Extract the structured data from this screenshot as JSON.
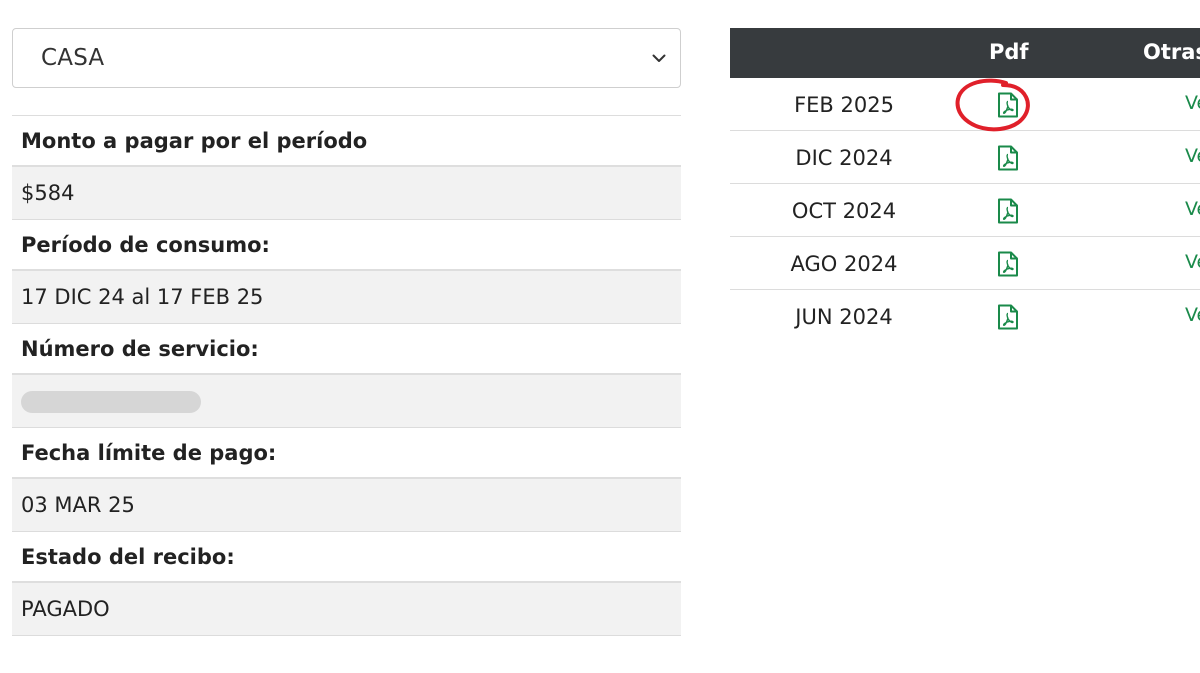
{
  "selector": {
    "value": "CASA"
  },
  "details": [
    {
      "label": "Monto a pagar por el período",
      "value": "$584"
    },
    {
      "label": "Período de consumo:",
      "value": "17 DIC 24 al 17 FEB 25"
    },
    {
      "label": "Número de servicio:",
      "value": ""
    },
    {
      "label": "Fecha límite de pago:",
      "value": "03 MAR 25"
    },
    {
      "label": "Estado del recibo:",
      "value": "PAGADO"
    }
  ],
  "table": {
    "headers": {
      "pdf": "Pdf",
      "otras": "Otras"
    },
    "rows": [
      {
        "period": "FEB 2025",
        "link": "Ver"
      },
      {
        "period": "DIC 2024",
        "link": "Ver"
      },
      {
        "period": "OCT 2024",
        "link": "Ver"
      },
      {
        "period": "AGO 2024",
        "link": "Ver"
      },
      {
        "period": "JUN 2024",
        "link": "Ver"
      }
    ]
  },
  "colors": {
    "header_bg": "#373b3e",
    "accent_green": "#1a8a4a",
    "annotation_red": "#e0202a",
    "row_alt_bg": "#f2f2f2"
  },
  "icons": {
    "pdf": "file-pdf-icon",
    "chevron": "chevron-down-icon"
  }
}
